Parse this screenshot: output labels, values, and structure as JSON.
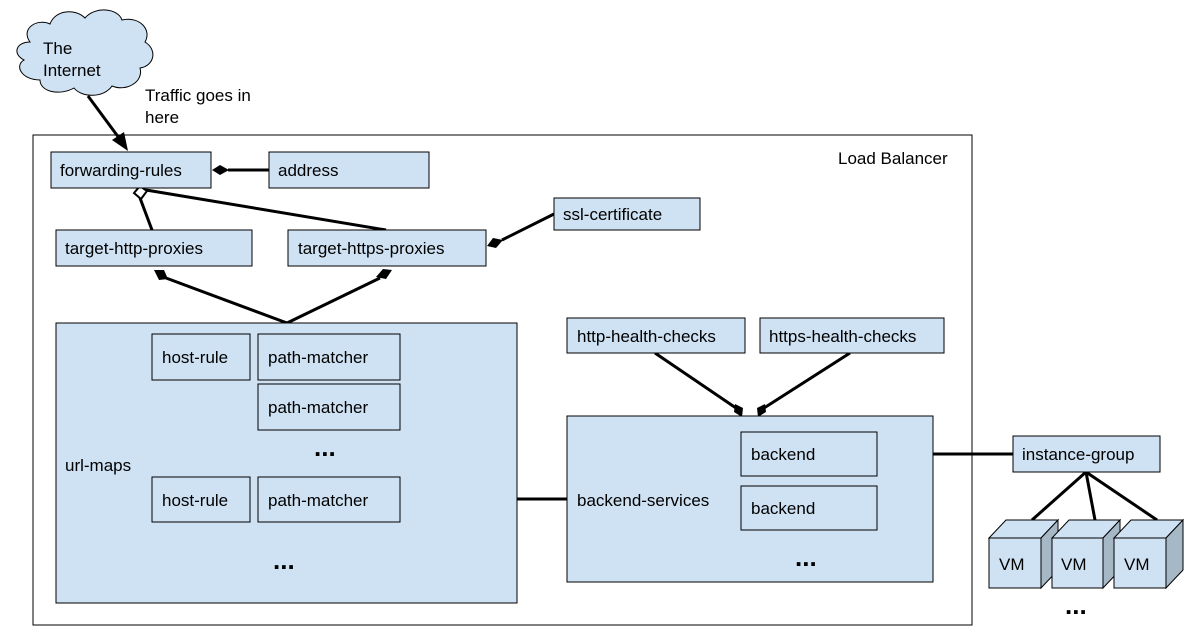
{
  "cloud": {
    "line1": "The",
    "line2": "Internet"
  },
  "traffic_note": {
    "line1": "Traffic goes in",
    "line2": "here"
  },
  "load_balancer": {
    "label": "Load Balancer"
  },
  "nodes": {
    "forwarding_rules": "forwarding-rules",
    "address": "address",
    "ssl_certificate": "ssl-certificate",
    "target_http_proxies": "target-http-proxies",
    "target_https_proxies": "target-https-proxies",
    "url_maps": "url-maps",
    "host_rule_1": "host-rule",
    "path_matcher_1": "path-matcher",
    "path_matcher_2": "path-matcher",
    "host_rule_2": "host-rule",
    "path_matcher_3": "path-matcher",
    "http_health_checks": "http-health-checks",
    "https_health_checks": "https-health-checks",
    "backend_services": "backend-services",
    "backend_1": "backend",
    "backend_2": "backend",
    "instance_group": "instance-group",
    "vm_1": "VM",
    "vm_2": "VM",
    "vm_3": "VM"
  },
  "ellipsis": "...",
  "colors": {
    "box_fill": "#cfe2f3",
    "vm_side": "#a6b7c6",
    "stroke": "#000000"
  }
}
